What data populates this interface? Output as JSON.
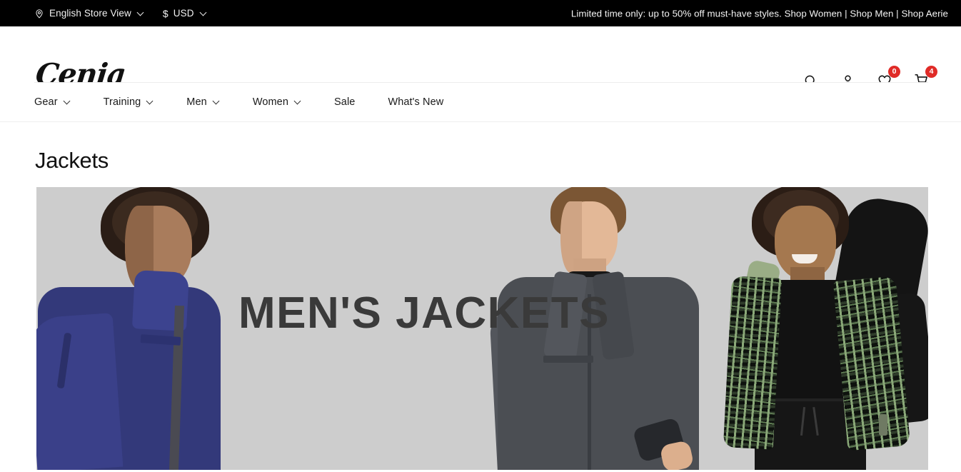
{
  "topbar": {
    "store_view": {
      "label": "English Store View",
      "icon": "location-pin-icon",
      "caret": "chevron-down-icon"
    },
    "currency": {
      "symbol": "$",
      "label": "USD",
      "caret": "chevron-down-icon"
    },
    "promo": {
      "message": "Limited time only: up to 50% off must-have styles.",
      "link_women": "Shop Women",
      "sep1": "|",
      "link_men": "Shop Men",
      "sep2": "|",
      "link_aerie": "Shop Aerie"
    }
  },
  "header": {
    "logo": "Cenia",
    "icons": {
      "search": "search-icon",
      "account": "account-icon",
      "wishlist": "wishlist-heart-icon",
      "wishlist_count": "0",
      "cart": "cart-icon",
      "cart_count": "4"
    }
  },
  "nav": {
    "items": [
      {
        "label": "Gear",
        "has_caret": true
      },
      {
        "label": "Training",
        "has_caret": true
      },
      {
        "label": "Men",
        "has_caret": true
      },
      {
        "label": "Women",
        "has_caret": true
      },
      {
        "label": "Sale",
        "has_caret": false
      },
      {
        "label": "What's New",
        "has_caret": false
      }
    ]
  },
  "main": {
    "page_title": "Jackets",
    "banner": {
      "headline": "MEN'S JACKETS",
      "background_color": "#cdcdcd",
      "headline_color": "#3a3a3a"
    }
  },
  "colors": {
    "topbar_bg": "#000000",
    "badge_red": "#e02b27",
    "text_dark": "#111111",
    "divider": "#ededed"
  }
}
